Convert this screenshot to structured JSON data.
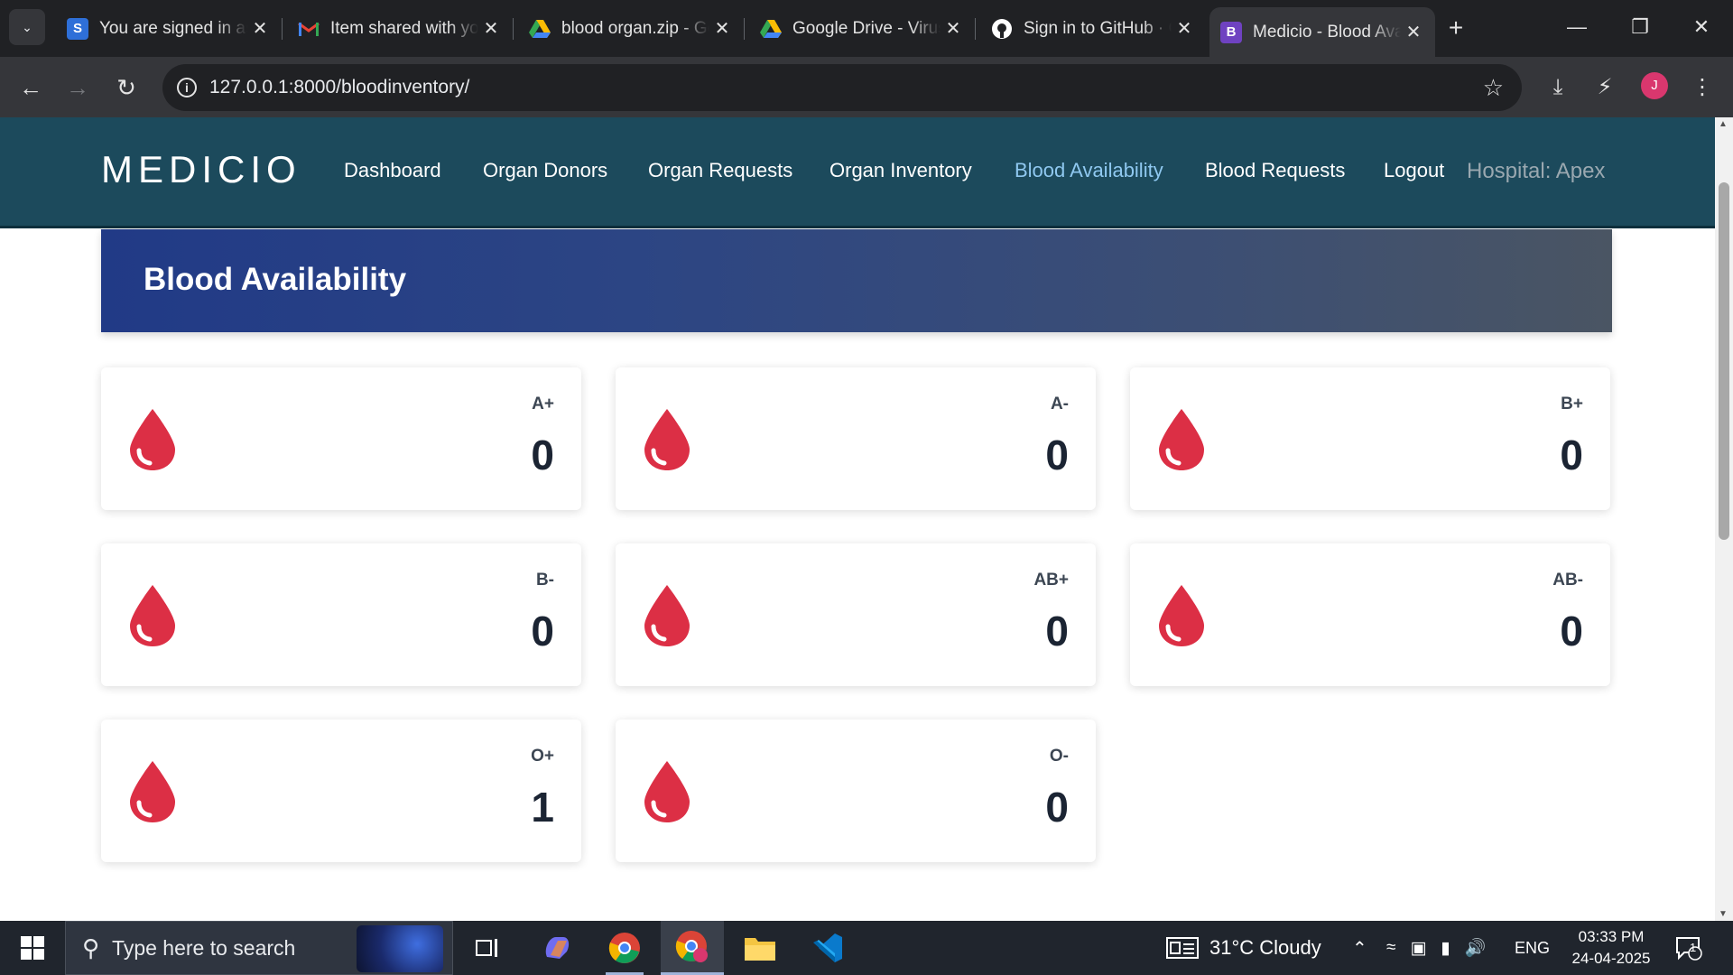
{
  "browser": {
    "tabs": [
      {
        "title": "You are signed in as",
        "favicon": "S",
        "favicon_color": "#2e6fd8"
      },
      {
        "title": "Item shared with you",
        "favicon": "M",
        "favicon_color": "#ea4335"
      },
      {
        "title": "blood organ.zip - Google Drive",
        "favicon": "drive",
        "favicon_color": "#34a853"
      },
      {
        "title": "Google Drive - Virus scan warning",
        "favicon": "drive",
        "favicon_color": "#34a853"
      },
      {
        "title": "Sign in to GitHub · GitHub",
        "favicon": "github",
        "favicon_color": "#ffffff"
      },
      {
        "title": "Medicio - Blood Availability",
        "favicon": "B",
        "favicon_color": "#6f42c1",
        "active": true
      }
    ],
    "close_glyph": "✕",
    "new_tab_glyph": "+",
    "url": "127.0.0.1:8000/bloodinventory/",
    "profile_initial": "J",
    "profile_color": "#d9376e"
  },
  "site": {
    "logo": "MEDICIO",
    "nav": [
      {
        "label": "Dashboard"
      },
      {
        "label": "Organ Donors"
      },
      {
        "label": "Organ Requests"
      },
      {
        "label": "Organ Inventory"
      },
      {
        "label": "Blood Availability",
        "active": true
      },
      {
        "label": "Blood Requests"
      },
      {
        "label": "Logout"
      }
    ],
    "hospital": "Hospital: Apex",
    "header_color": "#1c4a5c",
    "active_nav_color": "#8fc8f0"
  },
  "page": {
    "title": "Blood Availability",
    "drop_color": "#dc2f45",
    "cards": [
      {
        "group": "A+",
        "units": "0"
      },
      {
        "group": "A-",
        "units": "0"
      },
      {
        "group": "B+",
        "units": "0"
      },
      {
        "group": "B-",
        "units": "0"
      },
      {
        "group": "AB+",
        "units": "0"
      },
      {
        "group": "AB-",
        "units": "0"
      },
      {
        "group": "O+",
        "units": "1"
      },
      {
        "group": "O-",
        "units": "0"
      }
    ]
  },
  "taskbar": {
    "search_placeholder": "Type here to search",
    "weather": "31°C  Cloudy",
    "language": "ENG",
    "time": "03:33 PM",
    "date": "24-04-2025",
    "notification_count": "1"
  }
}
